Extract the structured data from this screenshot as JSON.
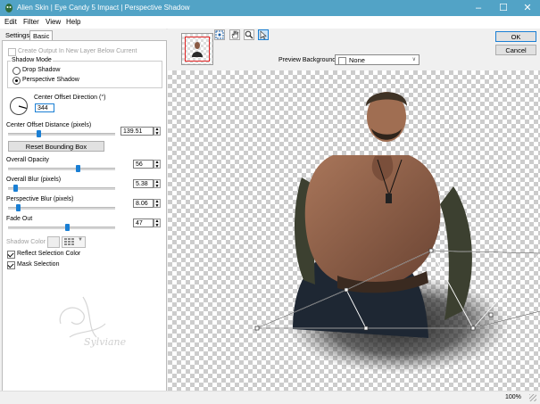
{
  "window": {
    "title": "Alien Skin | Eye Candy 5 Impact | Perspective Shadow"
  },
  "menu": [
    "Edit",
    "Filter",
    "View",
    "Help"
  ],
  "tabs": [
    "Settings",
    "Basic"
  ],
  "basic": {
    "create_output_label": "Create Output In New Layer Below Current",
    "shadow_mode_title": "Shadow Mode",
    "drop_shadow_label": "Drop Shadow",
    "perspective_shadow_label": "Perspective Shadow",
    "center_offset_direction_label": "Center Offset Direction (°)",
    "center_offset_direction_value": "344",
    "center_offset_distance_label": "Center Offset Distance (pixels)",
    "center_offset_distance_value": "139.51",
    "reset_bounding_box_label": "Reset Bounding Box",
    "overall_opacity_label": "Overall Opacity",
    "overall_opacity_value": "56",
    "overall_blur_label": "Overall Blur (pixels)",
    "overall_blur_value": "5.38",
    "perspective_blur_label": "Perspective Blur (pixels)",
    "perspective_blur_value": "8.06",
    "fade_out_label": "Fade Out",
    "fade_out_value": "47",
    "shadow_color_label": "Shadow Color",
    "reflect_selection_color_label": "Reflect Selection Color",
    "mask_selection_label": "Mask Selection"
  },
  "preview": {
    "background_label": "Preview Background:",
    "background_value": "None"
  },
  "buttons": {
    "ok": "OK",
    "cancel": "Cancel"
  },
  "status": {
    "zoom": "100%"
  },
  "watermark": "Sylviane"
}
